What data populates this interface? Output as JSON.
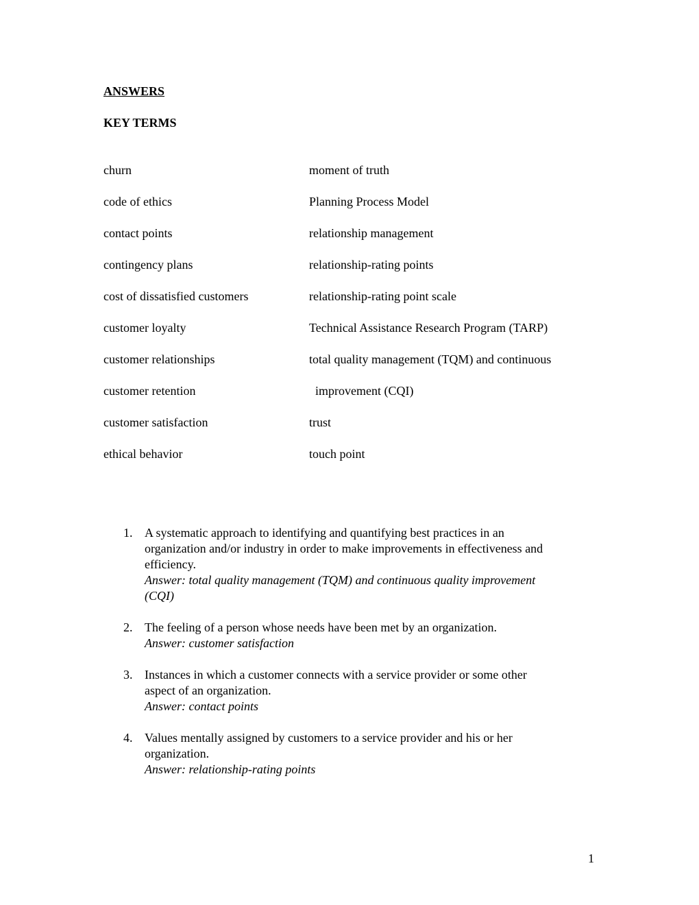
{
  "document": {
    "title": "ANSWERS",
    "section": "KEY TERMS",
    "key_terms": {
      "left": [
        "churn",
        "code of ethics",
        "contact points",
        "contingency plans",
        "cost of dissatisfied customers",
        "customer loyalty",
        "customer relationships",
        "customer retention",
        "customer satisfaction",
        "ethical behavior"
      ],
      "right": [
        "moment of truth",
        "Planning Process Model",
        "relationship management",
        "relationship-rating points",
        "relationship-rating point scale",
        "Technical Assistance Research Program (TARP)",
        "total quality management (TQM) and continuous",
        "  improvement (CQI)",
        "trust",
        "touch point"
      ]
    },
    "questions": [
      {
        "number": "1.",
        "lines": [
          "A systematic approach to identifying and quantifying best practices in an",
          "organization and/or industry in order to make improvements in effectiveness and",
          "efficiency."
        ],
        "answer_lines": [
          "Answer: total quality management (TQM) and continuous quality improvement",
          "(CQI)"
        ]
      },
      {
        "number": "2.",
        "lines": [
          "The feeling of a person whose needs have been met by an organization."
        ],
        "answer_lines": [
          "Answer: customer satisfaction"
        ]
      },
      {
        "number": "3.",
        "lines": [
          "Instances in which a customer connects with a service provider or some other",
          "aspect of an organization."
        ],
        "answer_lines": [
          "Answer: contact points"
        ]
      },
      {
        "number": "4.",
        "lines": [
          "Values mentally assigned by customers to a service provider and his or her",
          "organization."
        ],
        "answer_lines": [
          "Answer: relationship-rating points"
        ]
      }
    ],
    "page_number": "1"
  }
}
